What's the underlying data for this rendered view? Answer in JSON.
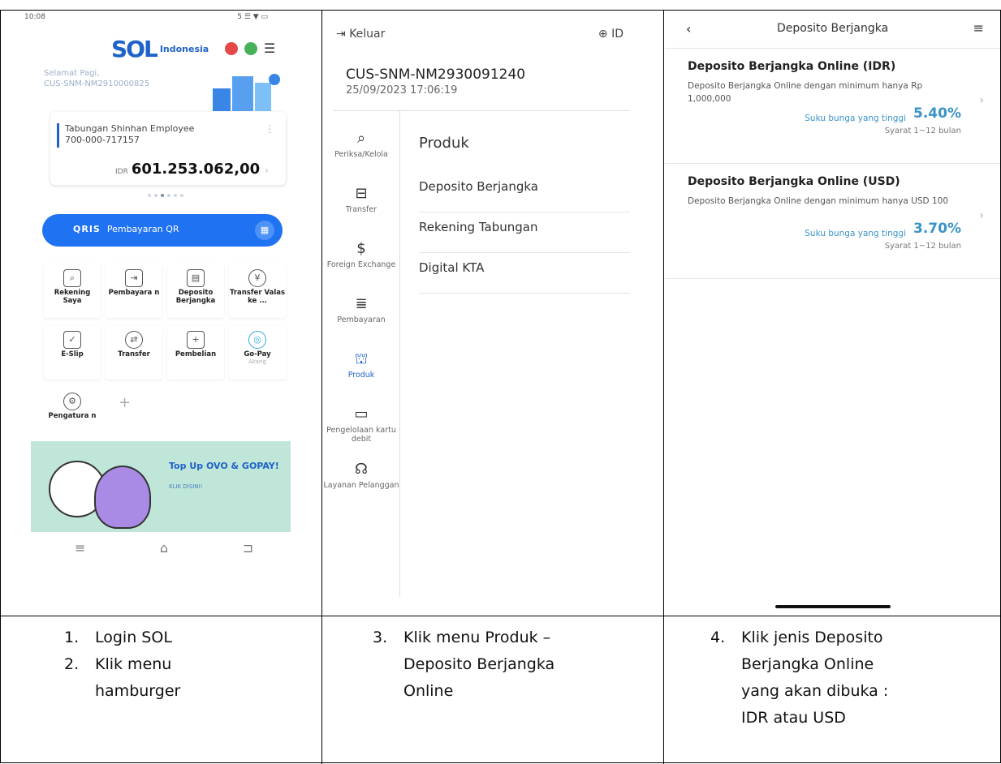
{
  "phone1": {
    "status_time": "10:08",
    "status_right": "5 ☰ ▼ ▭",
    "logo_mark": "SOL",
    "logo_text": "Indonesia",
    "greeting": "Selamat Pagi,",
    "customer": "CUS-SNM-NM2910000825",
    "account_name": "Tabungan Shinhan Employee",
    "account_number": "700-000-717157",
    "balance_currency": "IDR",
    "balance": "601.253.062,00",
    "qr_brand": "QRIS",
    "qr_label": "Pembayaran QR",
    "menu": [
      {
        "label": "Rekening Saya",
        "icon": "search-doc-icon"
      },
      {
        "label": "Pembayara n",
        "icon": "payment-icon"
      },
      {
        "label": "Deposito Berjangka",
        "icon": "deposit-icon"
      },
      {
        "label": "Transfer Valas ke ...",
        "icon": "fx-transfer-icon"
      },
      {
        "label": "E-Slip",
        "icon": "eslip-icon"
      },
      {
        "label": "Transfer",
        "icon": "transfer-icon"
      },
      {
        "label": "Pembelian",
        "icon": "purchase-icon"
      },
      {
        "label": "Go-Pay",
        "sub": "Akang",
        "icon": "gopay-icon"
      },
      {
        "label": "Pengatura n",
        "icon": "gear-icon"
      }
    ],
    "banner_title": "Top Up OVO & GOPAY!",
    "banner_sub": "KLIK DISINI!"
  },
  "phone2": {
    "keluar": "Keluar",
    "lang": "ID",
    "customer": "CUS-SNM-NM2930091240",
    "datetime": "25/09/2023 17:06:19",
    "side": [
      {
        "label": "Periksa/Kelola",
        "glyph": "⌕"
      },
      {
        "label": "Transfer",
        "glyph": "⊟"
      },
      {
        "label": "Foreign Exchange",
        "glyph": "$"
      },
      {
        "label": "Pembayaran",
        "glyph": "≣"
      },
      {
        "label": "Produk",
        "glyph": "⛫"
      },
      {
        "label": "Pengelolaan kartu debit",
        "glyph": "▭"
      },
      {
        "label": "Layanan Pelanggan",
        "glyph": "☊"
      }
    ],
    "section_title": "Produk",
    "products": [
      "Deposito Berjangka",
      "Rekening Tabungan",
      "Digital KTA"
    ]
  },
  "phone3": {
    "title": "Deposito Berjangka",
    "items": [
      {
        "title": "Deposito Berjangka Online (IDR)",
        "desc": "Deposito Berjangka Online dengan minimum hanya Rp 1,000,000",
        "rate_label": "Suku bunga yang tinggi",
        "rate": "5.40%",
        "term": "Syarat  1~12 bulan"
      },
      {
        "title": "Deposito Berjangka Online (USD)",
        "desc": "Deposito Berjangka Online dengan minimum hanya USD 100",
        "rate_label": "Suku bunga yang tinggi",
        "rate": "3.70%",
        "term": "Syarat  1~12 bulan"
      }
    ]
  },
  "captions": {
    "c1": {
      "n1": "1.",
      "l1": "Login SOL",
      "n2": "2.",
      "l2": "Klik menu",
      "l3": "hamburger"
    },
    "c2": {
      "n1": "3.",
      "l1": "Klik menu Produk –",
      "l2": "Deposito Berjangka",
      "l3": "Online"
    },
    "c3": {
      "n1": "4.",
      "l1": "Klik jenis Deposito",
      "l2": "Berjangka Online",
      "l3": "yang akan dibuka :",
      "l4": "IDR atau USD"
    }
  }
}
